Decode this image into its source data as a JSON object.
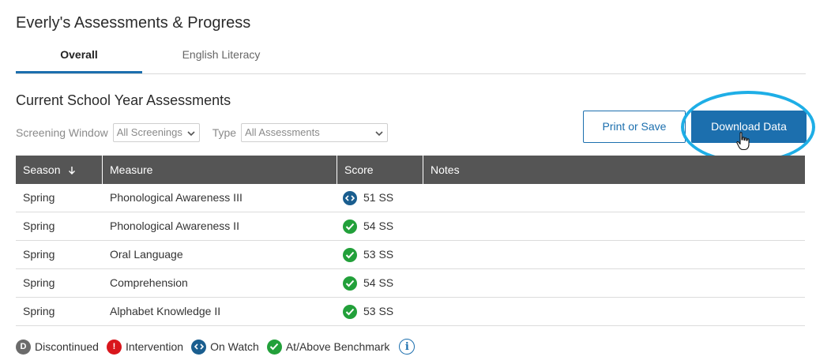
{
  "page": {
    "title": "Everly's Assessments & Progress"
  },
  "tabs": [
    {
      "label": "Overall",
      "active": true
    },
    {
      "label": "English Literacy",
      "active": false
    }
  ],
  "section": {
    "title": "Current School Year Assessments"
  },
  "filters": {
    "screening_label": "Screening Window",
    "screening_value": "All Screenings",
    "type_label": "Type",
    "type_value": "All Assessments"
  },
  "buttons": {
    "print": "Print or Save",
    "download": "Download Data"
  },
  "table": {
    "headers": {
      "season": "Season",
      "measure": "Measure",
      "score": "Score",
      "notes": "Notes"
    },
    "sort_icon": "arrow-down-icon",
    "rows": [
      {
        "season": "Spring",
        "measure": "Phonological Awareness III",
        "score": "51 SS",
        "status": "on-watch",
        "notes": ""
      },
      {
        "season": "Spring",
        "measure": "Phonological Awareness II",
        "score": "54 SS",
        "status": "at-above-benchmark",
        "notes": ""
      },
      {
        "season": "Spring",
        "measure": "Oral Language",
        "score": "53 SS",
        "status": "at-above-benchmark",
        "notes": ""
      },
      {
        "season": "Spring",
        "measure": "Comprehension",
        "score": "54 SS",
        "status": "at-above-benchmark",
        "notes": ""
      },
      {
        "season": "Spring",
        "measure": "Alphabet Knowledge II",
        "score": "53 SS",
        "status": "at-above-benchmark",
        "notes": ""
      }
    ]
  },
  "legend": {
    "discontinued": {
      "icon_letter": "D",
      "label": "Discontinued"
    },
    "intervention": {
      "icon_letter": "!",
      "label": "Intervention"
    },
    "on_watch": {
      "label": "On Watch"
    },
    "benchmark": {
      "label": "At/Above Benchmark"
    },
    "info_icon_glyph": "i"
  },
  "colors": {
    "primary": "#1c6fae",
    "on_watch": "#1a5e8f",
    "benchmark": "#22a03a",
    "intervention": "#d9161c",
    "discontinued": "#6b6b6b",
    "header_bg": "#555555",
    "highlight": "#1eaee6"
  }
}
